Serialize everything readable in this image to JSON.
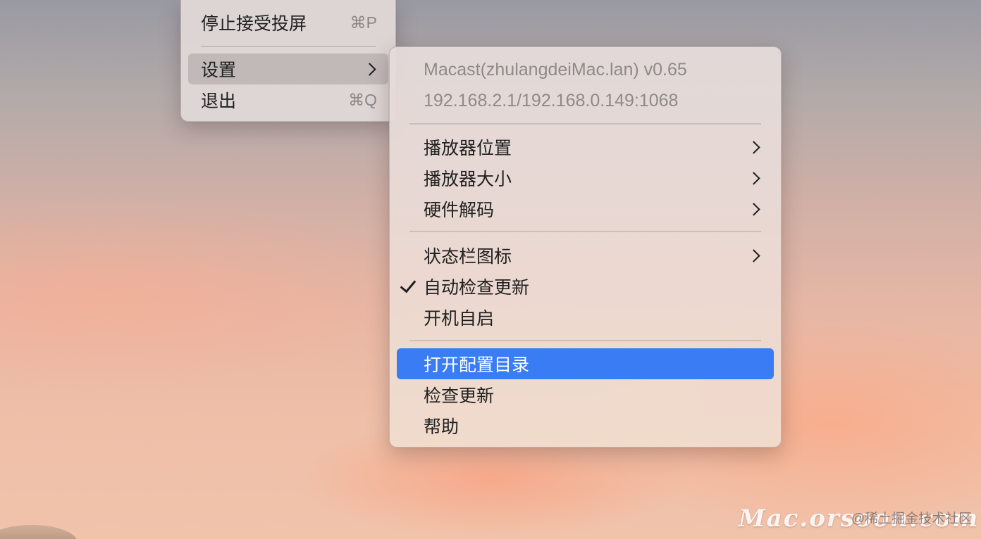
{
  "main_menu": {
    "items": [
      {
        "label": "停止接受投屏",
        "shortcut": "⌘P"
      },
      {
        "label": "设置",
        "has_submenu": true,
        "state": "hover"
      },
      {
        "label": "退出",
        "shortcut": "⌘Q"
      }
    ]
  },
  "settings_submenu": {
    "info": [
      "Macast(zhulangdeiMac.lan) v0.65",
      "192.168.2.1/192.168.0.149:1068"
    ],
    "items": [
      {
        "label": "播放器位置",
        "has_submenu": true
      },
      {
        "label": "播放器大小",
        "has_submenu": true
      },
      {
        "label": "硬件解码",
        "has_submenu": true
      },
      {
        "label": "状态栏图标",
        "has_submenu": true
      },
      {
        "label": "自动检查更新",
        "checked": true
      },
      {
        "label": "开机自启"
      },
      {
        "label": "打开配置目录",
        "state": "selected"
      },
      {
        "label": "检查更新"
      },
      {
        "label": "帮助"
      }
    ]
  },
  "watermark": {
    "site": "Mac.orsoon.com",
    "community": "@稀土掘金技术社区"
  },
  "colors": {
    "selection": "#3a7cf4",
    "hover": "#b3aaaa",
    "disabled_text": "#8e8a89"
  }
}
